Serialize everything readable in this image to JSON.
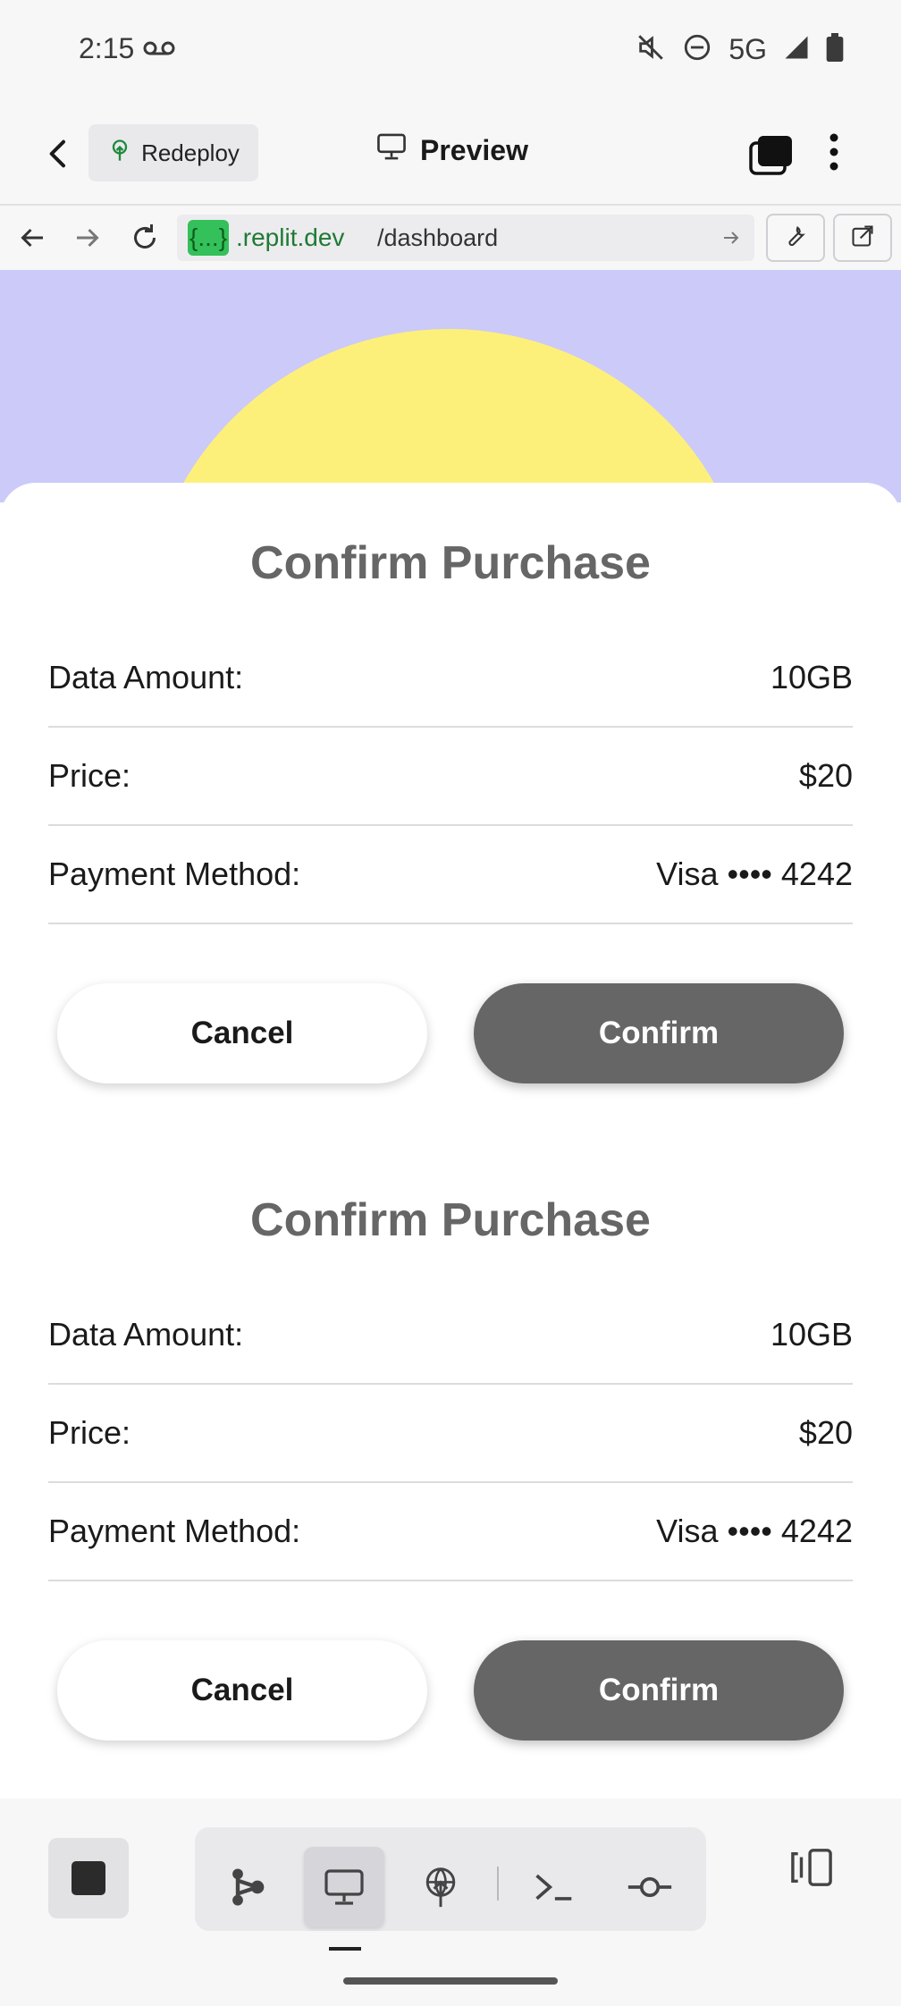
{
  "status_bar": {
    "time": "2:15",
    "network": "5G"
  },
  "app_header": {
    "redeploy_label": "Redeploy",
    "preview_label": "Preview"
  },
  "url_bar": {
    "host_chip": "{...}",
    "host": ".replit.dev",
    "path": "/dashboard"
  },
  "dialogs": [
    {
      "title": "Confirm Purchase",
      "rows": [
        {
          "label": "Data Amount:",
          "value": "10GB"
        },
        {
          "label": "Price:",
          "value": "$20"
        },
        {
          "label": "Payment Method:",
          "value": "Visa •••• 4242"
        }
      ],
      "cancel_label": "Cancel",
      "confirm_label": "Confirm"
    },
    {
      "title": "Confirm Purchase",
      "rows": [
        {
          "label": "Data Amount:",
          "value": "10GB"
        },
        {
          "label": "Price:",
          "value": "$20"
        },
        {
          "label": "Payment Method:",
          "value": "Visa •••• 4242"
        }
      ],
      "cancel_label": "Cancel",
      "confirm_label": "Confirm"
    }
  ],
  "colors": {
    "hero_background": "#cbcaf9",
    "sun": "#fdf07a",
    "confirm_button": "#666666",
    "url_chip": "#34c05a"
  },
  "toolbar": {
    "icons": [
      "stop-icon",
      "agent-icon",
      "preview-icon",
      "deploy-icon",
      "shell-icon",
      "git-commit-icon",
      "layout-toggle-icon"
    ],
    "active": "preview-icon"
  }
}
